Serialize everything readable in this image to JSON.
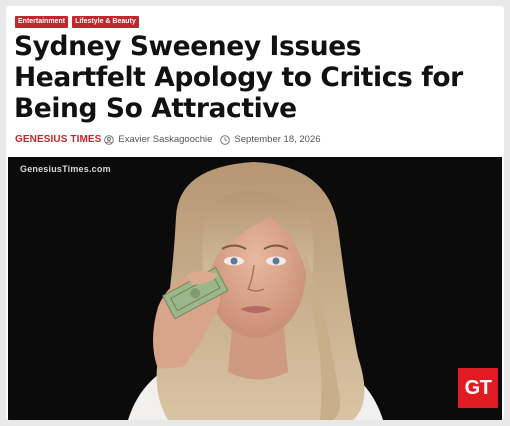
{
  "article": {
    "tags": [
      "Entertainment",
      "Lifestyle & Beauty"
    ],
    "headline": "Sydney Sweeney Issues Heartfelt Apology to Critics for Being So Attractive",
    "meta": {
      "brand": "GENESIUS TIMES",
      "author": "Exavier Saskagoochie",
      "date": "September 18, 2026",
      "author_icon": "user-circle-icon",
      "date_icon": "clock-icon"
    }
  },
  "image": {
    "watermark": "GenesiusTimes.com",
    "logo": "GT"
  },
  "colors": {
    "accent": "#c0262d",
    "logo_bg": "#e01b22",
    "image_bg": "#0b0b0b"
  }
}
